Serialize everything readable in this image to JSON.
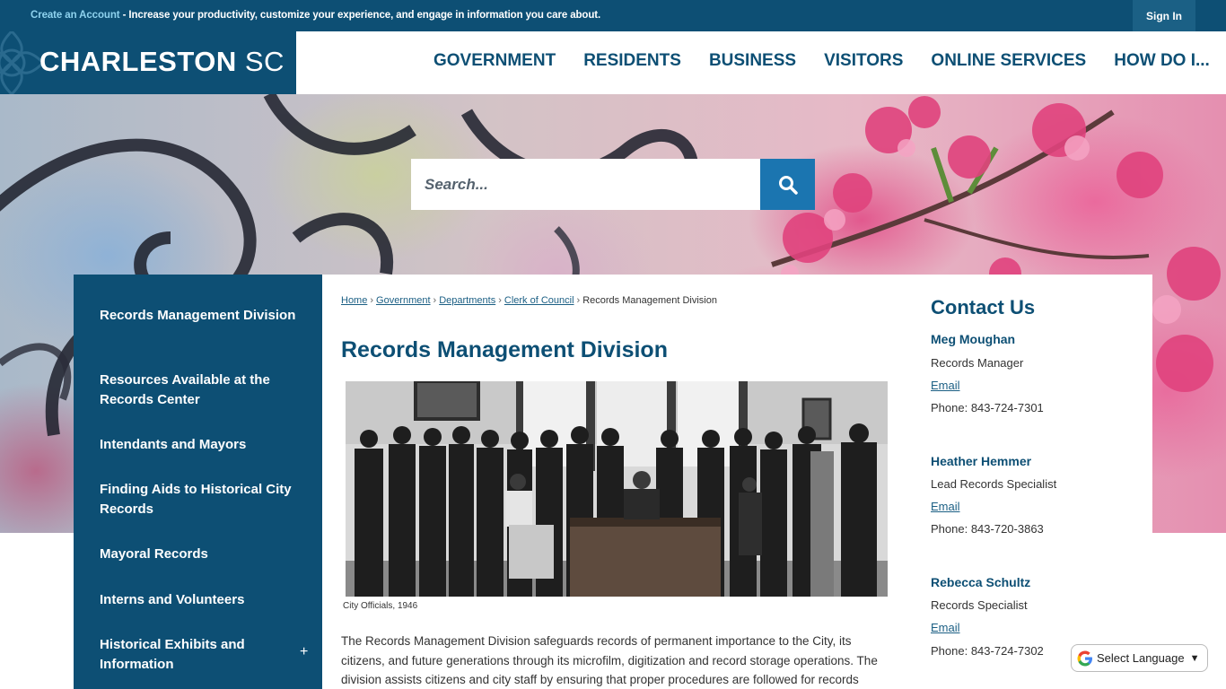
{
  "topbar": {
    "create_account_link": "Create an Account",
    "promo_text": " - Increase your productivity, customize your experience, and engage in information you care about.",
    "sign_in": "Sign In"
  },
  "header": {
    "logo_name": "CHARLESTON",
    "logo_state": "SC",
    "nav": [
      "GOVERNMENT",
      "RESIDENTS",
      "BUSINESS",
      "VISITORS",
      "ONLINE SERVICES",
      "HOW DO I..."
    ]
  },
  "search": {
    "placeholder": "Search...",
    "icon": "search-icon"
  },
  "sidebar": {
    "items": [
      {
        "label": "Records Management Division"
      },
      {
        "label": "Resources Available at the Records Center"
      },
      {
        "label": "Intendants and Mayors"
      },
      {
        "label": "Finding Aids to Historical City Records"
      },
      {
        "label": "Mayoral Records"
      },
      {
        "label": "Interns and Volunteers"
      },
      {
        "label": "Historical Exhibits and Information"
      }
    ],
    "expand_symbol": "+"
  },
  "breadcrumb": {
    "links": [
      "Home",
      "Government",
      "Departments",
      "Clerk of Council"
    ],
    "separator": "›",
    "current": "Records Management Division"
  },
  "page": {
    "title": "Records Management Division",
    "photo_caption": "City Officials, 1946",
    "body": "The Records Management Division safeguards records of permanent importance to the City, its citizens, and future generations through its microfilm, digitization and record storage operations. The division assists citizens and city staff by ensuring that proper procedures are followed for records"
  },
  "contact": {
    "title": "Contact Us",
    "people": [
      {
        "name": "Meg Moughan",
        "role": "Records Manager",
        "email_label": "Email",
        "phone": "Phone: 843-724-7301"
      },
      {
        "name": "Heather Hemmer",
        "role": "Lead Records Specialist",
        "email_label": "Email",
        "phone": "Phone: 843-720-3863"
      },
      {
        "name": "Rebecca Schultz",
        "role": "Records Specialist",
        "email_label": "Email",
        "phone": "Phone: 843-724-7302"
      }
    ]
  },
  "translate": {
    "label": "Select Language",
    "icon": "google-icon"
  },
  "colors": {
    "brand_navy": "#0d4f74",
    "search_button": "#1b75b0",
    "link": "#1b5f84"
  }
}
